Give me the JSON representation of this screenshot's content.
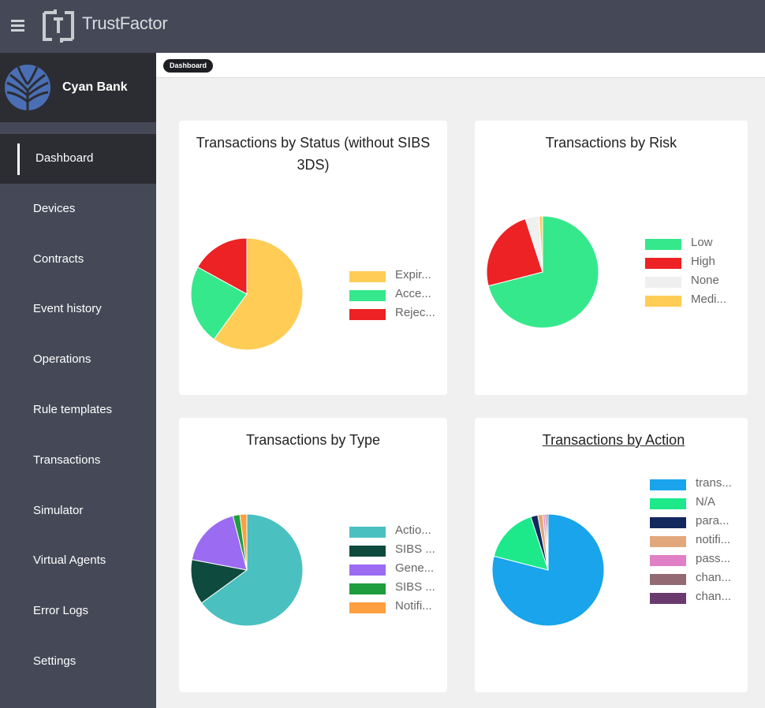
{
  "app": {
    "title": "TrustFactor"
  },
  "bank": {
    "name": "Cyan Bank"
  },
  "nav": [
    {
      "label": "Dashboard",
      "active": true
    },
    {
      "label": "Devices"
    },
    {
      "label": "Contracts"
    },
    {
      "label": "Event history"
    },
    {
      "label": "Operations"
    },
    {
      "label": "Rule templates"
    },
    {
      "label": "Transactions"
    },
    {
      "label": "Simulator"
    },
    {
      "label": "Virtual Agents"
    },
    {
      "label": "Error Logs"
    },
    {
      "label": "Settings"
    }
  ],
  "breadcrumb": {
    "label": "Dashboard"
  },
  "colors": {
    "sidebar": "#454957",
    "sidebar_active": "#2c2d33",
    "bank_logo": "#4a6fb5"
  },
  "chart_data": [
    {
      "type": "pie",
      "title": "Transactions by Status (without SIBS 3DS)",
      "labels": [
        "Expir...",
        "Acce...",
        "Rejec..."
      ],
      "values": [
        60,
        23,
        17
      ],
      "colors": [
        "#ffcd56",
        "#36e88c",
        "#ec2224"
      ]
    },
    {
      "type": "pie",
      "title": "Transactions by Risk",
      "labels": [
        "Low",
        "High",
        "None",
        "Medi..."
      ],
      "values": [
        71,
        24,
        4,
        1
      ],
      "colors": [
        "#36e88c",
        "#ec2224",
        "#f0f0f0",
        "#ffcd56"
      ]
    },
    {
      "type": "pie",
      "title": "Transactions by Type",
      "labels": [
        "Actio...",
        "SIBS ...",
        "Gene...",
        "SIBS ...",
        "Notifi..."
      ],
      "values": [
        65,
        13,
        18,
        2,
        2
      ],
      "colors": [
        "#4bc0c0",
        "#0e4a3e",
        "#9b6bf2",
        "#1e9e3e",
        "#ff9f40"
      ]
    },
    {
      "type": "pie",
      "title": "Transactions by Action",
      "labels": [
        "trans...",
        "N/A",
        "para...",
        "notifi...",
        "pass...",
        "chan...",
        "chan..."
      ],
      "values": [
        79,
        16,
        2,
        1.5,
        0.6,
        0.5,
        0.4
      ],
      "colors": [
        "#19a4ec",
        "#1de98b",
        "#13295e",
        "#e2a87c",
        "#e07fc6",
        "#936a73",
        "#6a3a6e"
      ]
    }
  ]
}
